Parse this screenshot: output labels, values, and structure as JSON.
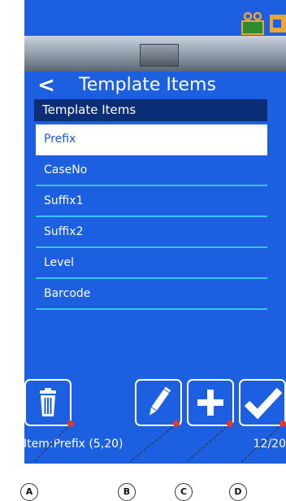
{
  "screen": {
    "title": "Template Items",
    "list_header": "Template Items",
    "items": [
      {
        "label": "Prefix",
        "selected": true
      },
      {
        "label": "CaseNo",
        "selected": false
      },
      {
        "label": "Suffix1",
        "selected": false
      },
      {
        "label": "Suffix2",
        "selected": false
      },
      {
        "label": "Level",
        "selected": false
      },
      {
        "label": "Barcode",
        "selected": false
      }
    ],
    "item_info": "Item:Prefix (5,20)",
    "count": "12/20",
    "back_symbol": "<"
  },
  "toolbar": {
    "delete_icon": "trash-icon",
    "edit_icon": "pencil-icon",
    "add_icon": "plus-icon",
    "confirm_icon": "checkmark-icon"
  },
  "callouts": [
    "A",
    "B",
    "C",
    "D"
  ],
  "colors": {
    "screen_bg": "#1c5fe0",
    "header_bg": "#0b2d75",
    "divider": "#39c5f0",
    "callout_dot": "#e03a2a"
  }
}
